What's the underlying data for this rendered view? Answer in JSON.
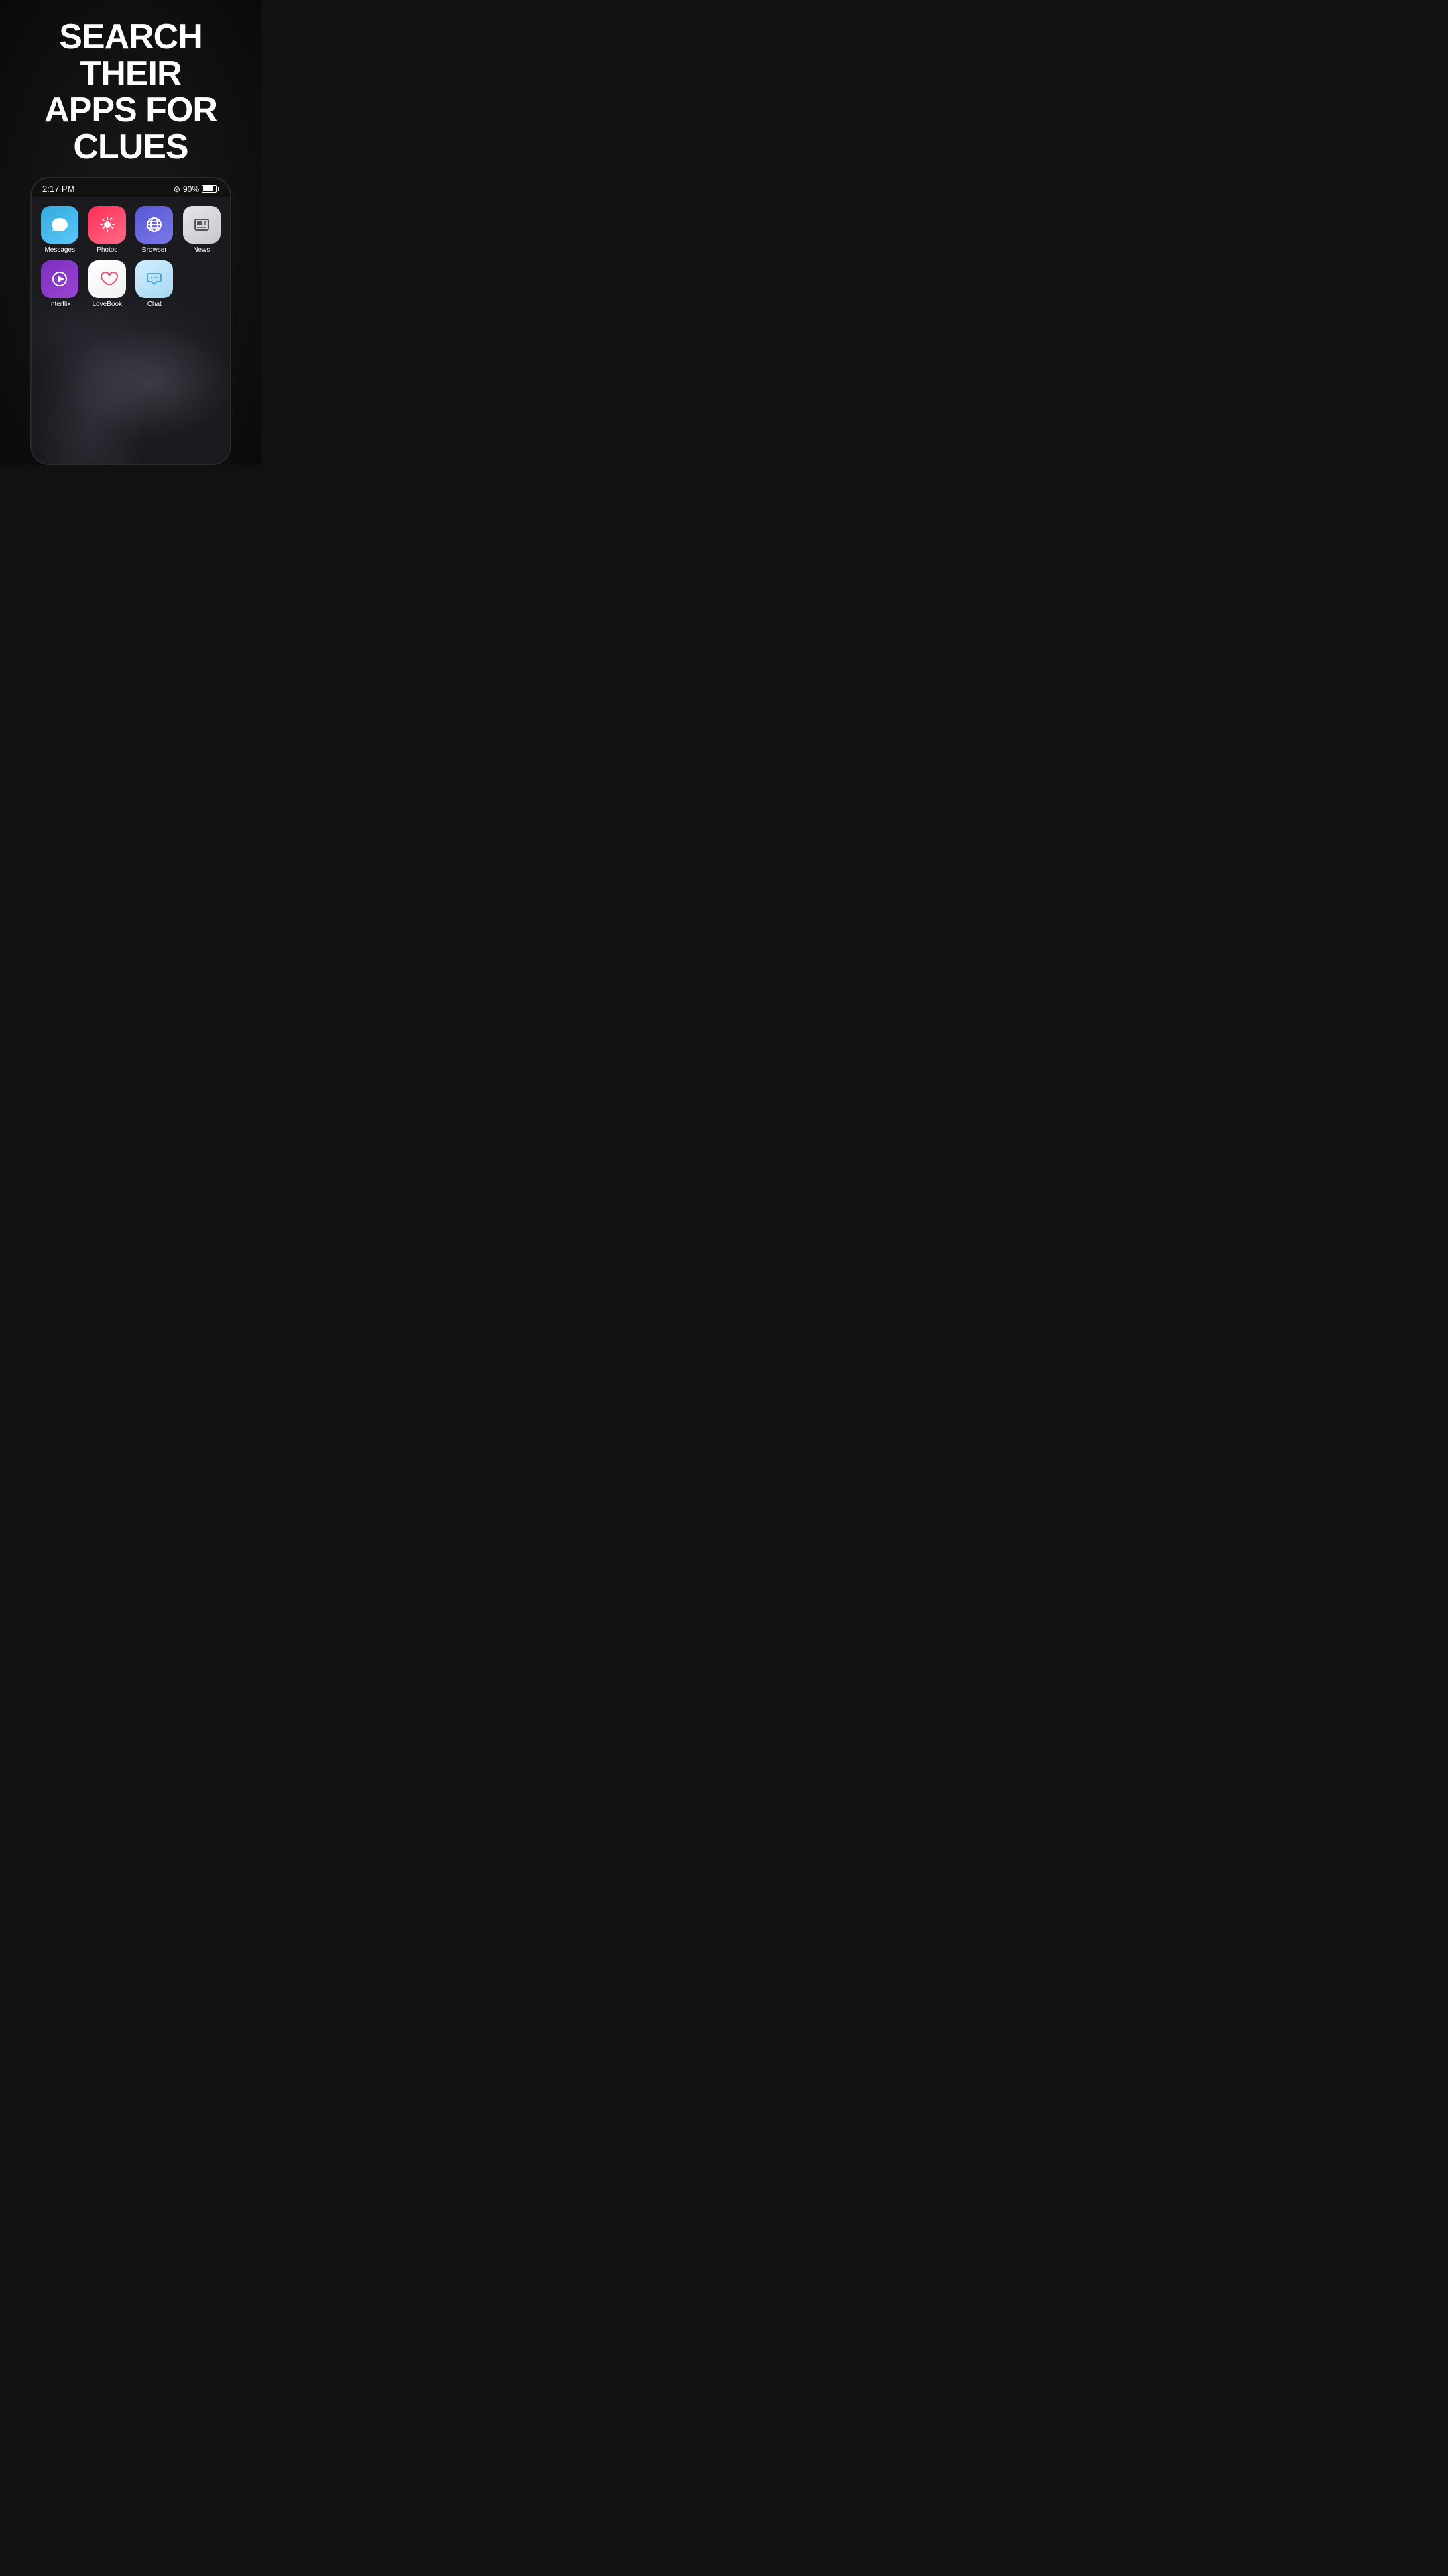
{
  "headline": {
    "line1": "SEARCH THEIR",
    "line2": "APPS FOR CLUES"
  },
  "statusBar": {
    "time": "2:17 PM",
    "battery_percent": "90%"
  },
  "apps": {
    "row1": [
      {
        "id": "messages",
        "label": "Messages",
        "iconType": "messages"
      },
      {
        "id": "photos",
        "label": "Photos",
        "iconType": "photos"
      },
      {
        "id": "browser",
        "label": "Browser",
        "iconType": "browser"
      },
      {
        "id": "news",
        "label": "News",
        "iconType": "news"
      }
    ],
    "row2": [
      {
        "id": "interflix",
        "label": "Interflix",
        "iconType": "interflix"
      },
      {
        "id": "lovebook",
        "label": "LoveBook",
        "iconType": "lovebook"
      },
      {
        "id": "chat",
        "label": "Chat",
        "iconType": "chat"
      }
    ]
  }
}
